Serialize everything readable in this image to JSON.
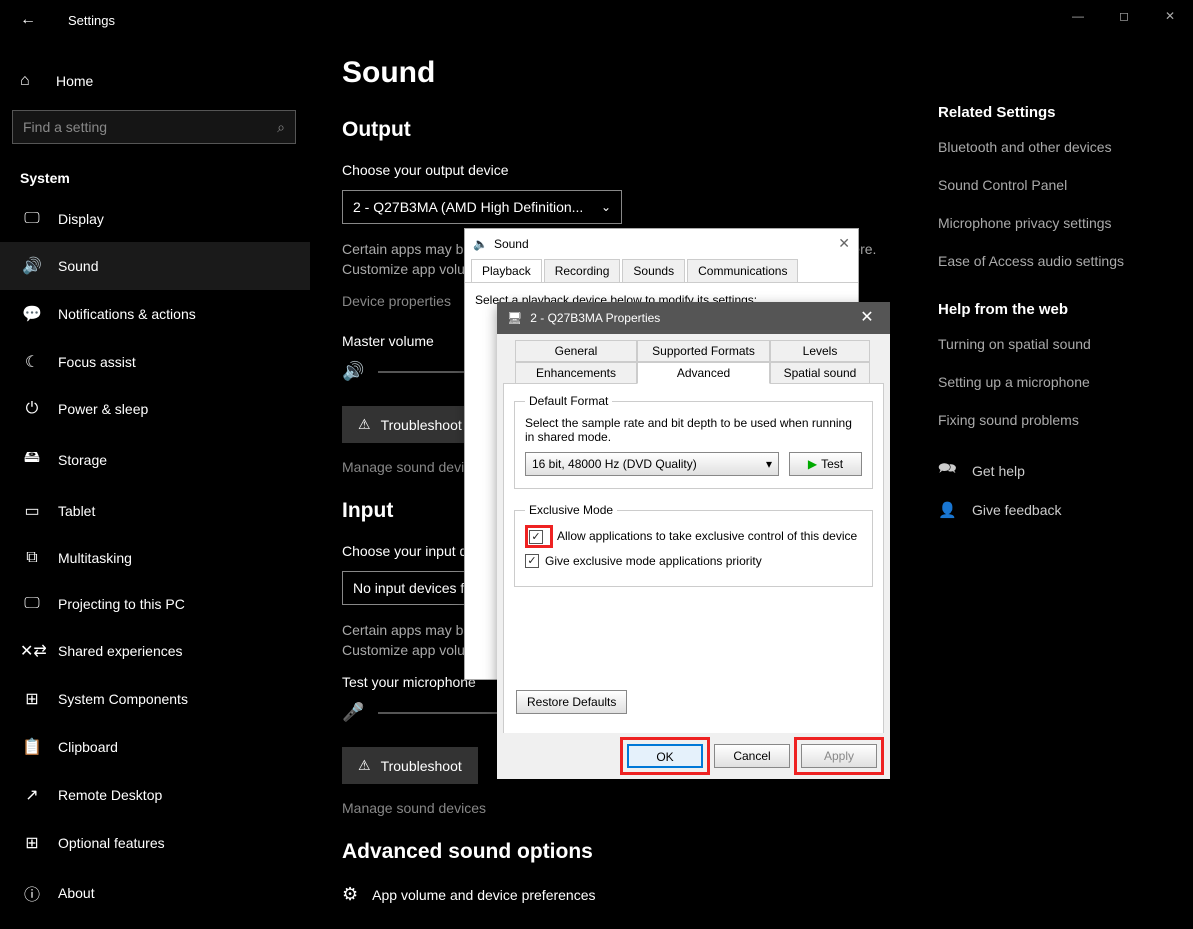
{
  "titlebar": {
    "title": "Settings"
  },
  "sidebar": {
    "home": "Home",
    "search_placeholder": "Find a setting",
    "category": "System",
    "items": [
      {
        "icon": "🖵",
        "label": "Display"
      },
      {
        "icon": "🔊",
        "label": "Sound",
        "active": true
      },
      {
        "icon": "💬",
        "label": "Notifications & actions"
      },
      {
        "icon": "☾",
        "label": "Focus assist"
      },
      {
        "icon": "⏻",
        "label": "Power & sleep"
      },
      {
        "icon": "🖴",
        "label": "Storage"
      },
      {
        "icon": "▭",
        "label": "Tablet"
      },
      {
        "icon": "⧉",
        "label": "Multitasking"
      },
      {
        "icon": "🖵",
        "label": "Projecting to this PC"
      },
      {
        "icon": "✕⇄",
        "label": "Shared experiences"
      },
      {
        "icon": "⊞",
        "label": "System Components"
      },
      {
        "icon": "📋",
        "label": "Clipboard"
      },
      {
        "icon": "↗",
        "label": "Remote Desktop"
      },
      {
        "icon": "⊞",
        "label": "Optional features"
      },
      {
        "icon": "ⓘ",
        "label": "About"
      }
    ]
  },
  "page": {
    "title": "Sound",
    "output_heading": "Output",
    "output_choose": "Choose your output device",
    "output_device": "2 - Q27B3MA (AMD High Definition...",
    "output_note": "Certain apps may be set up to use different sound devices than the one selected here. Customize app volumes and devices in advanced sound options.",
    "device_props": "Device properties",
    "master_volume": "Master volume",
    "troubleshoot": "Troubleshoot",
    "manage": "Manage sound devices",
    "input_heading": "Input",
    "input_choose": "Choose your input device",
    "input_device": "No input devices found",
    "input_note": "Certain apps may be set up to use different sound devices than the one selected here. Customize app volumes and devices in advanced sound options.",
    "test_mic": "Test your microphone",
    "advanced_heading": "Advanced sound options",
    "app_vol": "App volume and device preferences"
  },
  "right": {
    "related_heading": "Related Settings",
    "links": [
      "Bluetooth and other devices",
      "Sound Control Panel",
      "Microphone privacy settings",
      "Ease of Access audio settings"
    ],
    "help_heading": "Help from the web",
    "help_links": [
      "Turning on spatial sound",
      "Setting up a microphone",
      "Fixing sound problems"
    ],
    "get_help": "Get help",
    "feedback": "Give feedback"
  },
  "sound_dlg": {
    "title": "Sound",
    "tabs": [
      "Playback",
      "Recording",
      "Sounds",
      "Communications"
    ],
    "desc": "Select a playback device below to modify its settings:"
  },
  "props_dlg": {
    "title": "2 - Q27B3MA Properties",
    "tabs_top": [
      "General",
      "Supported Formats",
      "Levels"
    ],
    "tabs_bot": [
      "Enhancements",
      "Advanced",
      "Spatial sound"
    ],
    "default_format_legend": "Default Format",
    "default_format_desc": "Select the sample rate and bit depth to be used when running in shared mode.",
    "format_value": "16 bit, 48000 Hz (DVD Quality)",
    "test": "Test",
    "exclusive_legend": "Exclusive Mode",
    "exclusive_chk1": "Allow applications to take exclusive control of this device",
    "exclusive_chk2": "Give exclusive mode applications priority",
    "restore": "Restore Defaults",
    "ok": "OK",
    "cancel": "Cancel",
    "apply": "Apply"
  }
}
